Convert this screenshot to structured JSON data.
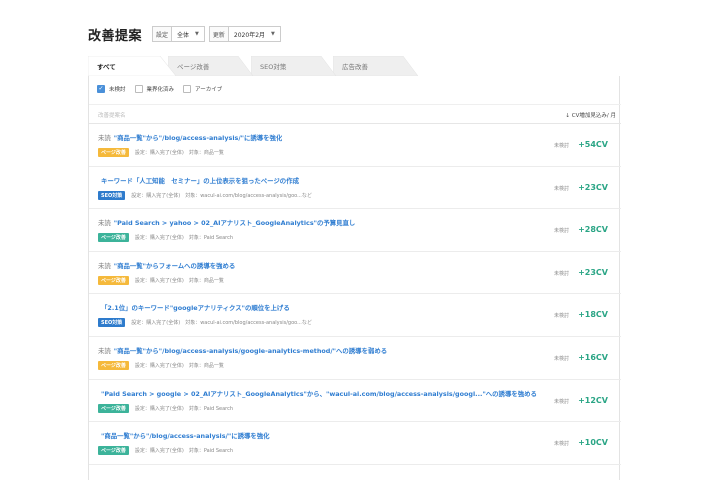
{
  "header": {
    "title": "改善提案",
    "setting_label": "設定",
    "setting_value": "全体",
    "update_label": "更新",
    "update_value": "2020年2月"
  },
  "tabs": [
    {
      "label": "すべて",
      "active": true
    },
    {
      "label": "ページ改善",
      "active": false
    },
    {
      "label": "SEO対策",
      "active": false
    },
    {
      "label": "広告改善",
      "active": false
    }
  ],
  "filters": [
    {
      "label": "未検討",
      "checked": true
    },
    {
      "label": "業界化済み",
      "checked": false
    },
    {
      "label": "アーカイブ",
      "checked": false
    }
  ],
  "table": {
    "col_left": "改善提案名",
    "col_right": "CV増加見込み/ 月"
  },
  "rows": [
    {
      "prefix": "未読",
      "title": "\"商品一覧\"から\"/blog/access-analysis/\"に誘導を強化",
      "badge": "ページ改善",
      "badge_type": "page",
      "meta1": "設定：購入完了(全体)",
      "meta2": "対象：商品一覧",
      "status": "未検討",
      "cv": "+54CV"
    },
    {
      "prefix": "",
      "title": "キーワード「人工知能　セミナー」の上位表示を狙ったページの作成",
      "badge": "SEO対策",
      "badge_type": "seo",
      "meta1": "設定：購入完了(全体)",
      "meta2": "対象：wacul-ai.com/blog/access-analysis/goo...など",
      "status": "未検討",
      "cv": "+23CV"
    },
    {
      "prefix": "未読",
      "title": "\"Paid Search > yahoo > 02_AIアナリスト_GoogleAnalytics\"の予算見直し",
      "badge": "ページ改善",
      "badge_type": "page-green",
      "meta1": "設定：購入完了(全体)",
      "meta2": "対象：Paid Search",
      "status": "未検討",
      "cv": "+28CV"
    },
    {
      "prefix": "未読",
      "title": "\"商品一覧\"からフォームへの誘導を強める",
      "badge": "ページ改善",
      "badge_type": "page",
      "meta1": "設定：購入完了(全体)",
      "meta2": "対象：商品一覧",
      "status": "未検討",
      "cv": "+23CV"
    },
    {
      "prefix": "",
      "title": "「2.1位」のキーワード\"googleアナリティクス\"の順位を上げる",
      "badge": "SEO対策",
      "badge_type": "seo",
      "meta1": "設定：購入完了(全体)",
      "meta2": "対象：wacul-ai.com/blog/access-analysis/goo...など",
      "status": "未検討",
      "cv": "+18CV"
    },
    {
      "prefix": "未読",
      "title": "\"商品一覧\"から\"/blog/access-analysis/google-analytics-method/\"への誘導を弱める",
      "badge": "ページ改善",
      "badge_type": "page",
      "meta1": "設定：購入完了(全体)",
      "meta2": "対象：商品一覧",
      "status": "未検討",
      "cv": "+16CV"
    },
    {
      "prefix": "",
      "title": "\"Paid Search > google > 02_AIアナリスト_GoogleAnalytics\"から、\"wacul-ai.com/blog/access-analysis/googl...\"への誘導を強める",
      "badge": "ページ改善",
      "badge_type": "page-green",
      "meta1": "設定：購入完了(全体)",
      "meta2": "対象：Paid Search",
      "status": "未検討",
      "cv": "+12CV"
    },
    {
      "prefix": "",
      "title": "\"商品一覧\"から\"/blog/access-analysis/\"に誘導を強化",
      "badge": "ページ改善",
      "badge_type": "page-green",
      "meta1": "設定：購入完了(全体)",
      "meta2": "対象：Paid Search",
      "status": "未検討",
      "cv": "+10CV"
    }
  ],
  "colors": {
    "link": "#2f7dd1",
    "cv": "#2aa585",
    "badge_page": "#f5b93b",
    "badge_page_green": "#3cb39a",
    "badge_seo": "#2e7bcc",
    "checkbox": "#4a90d9"
  }
}
